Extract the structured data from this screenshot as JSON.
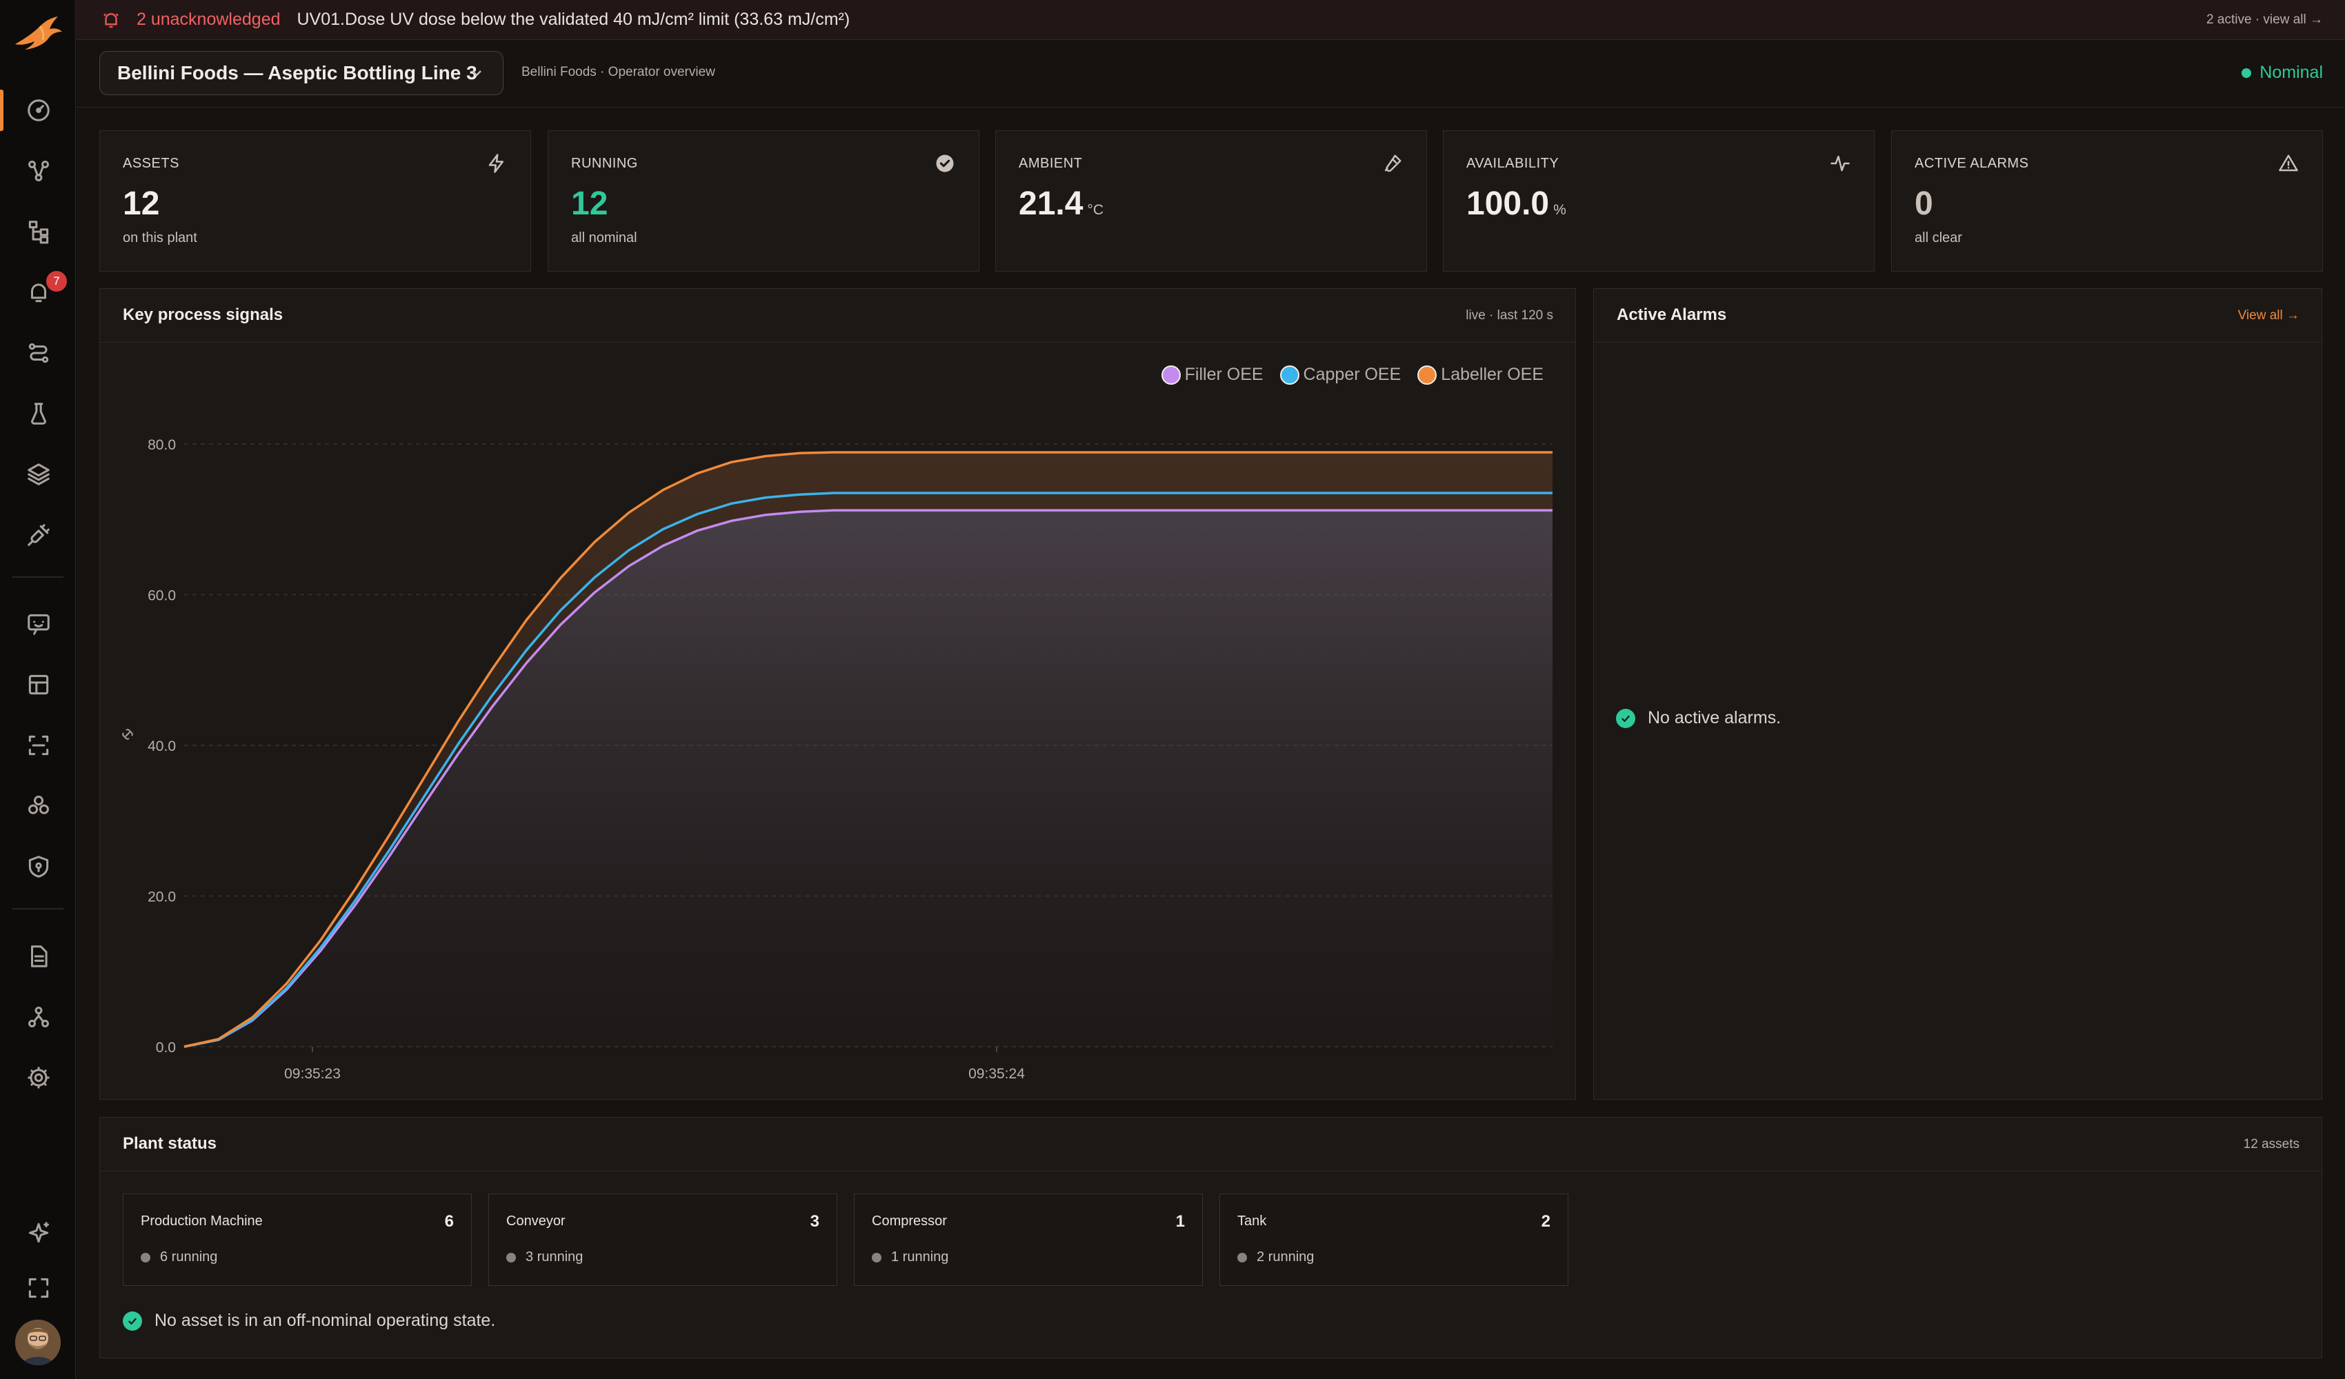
{
  "banner": {
    "unacknowledged": "2 unacknowledged",
    "message": "UV01.Dose UV dose below the validated 40 mJ/cm² limit (33.63 mJ/cm²)",
    "right": "2 active · view all →"
  },
  "header": {
    "plant": "Bellini Foods — Aseptic Bottling Line 3",
    "subtitle": "Bellini Foods · Operator overview",
    "status": "Nominal"
  },
  "sidebar": {
    "alarm_badge": "7"
  },
  "kpis": [
    {
      "label": "ASSETS",
      "value": "12",
      "unit": "",
      "sub": "on this plant",
      "icon": "bolt-icon"
    },
    {
      "label": "RUNNING",
      "value": "12",
      "unit": "",
      "sub": "all nominal",
      "icon": "check-circle-icon"
    },
    {
      "label": "AMBIENT",
      "value": "21.4",
      "unit": "°C",
      "sub": "",
      "icon": "thermometer-icon"
    },
    {
      "label": "AVAILABILITY",
      "value": "100.0",
      "unit": "%",
      "sub": "",
      "icon": "pulse-icon"
    },
    {
      "label": "ACTIVE ALARMS",
      "value": "0",
      "unit": "",
      "sub": "all clear",
      "icon": "warning-icon"
    }
  ],
  "signals": {
    "title": "Key process signals",
    "meta": "live · last 120 s"
  },
  "alarms": {
    "title": "Active Alarms",
    "view_all": "View all →",
    "empty": "No active alarms."
  },
  "plant_status": {
    "title": "Plant status",
    "meta": "12 assets",
    "types": [
      {
        "name": "Production Machine",
        "count": "6",
        "running": "6 running"
      },
      {
        "name": "Conveyor",
        "count": "3",
        "running": "3 running"
      },
      {
        "name": "Compressor",
        "count": "1",
        "running": "1 running"
      },
      {
        "name": "Tank",
        "count": "2",
        "running": "2 running"
      }
    ],
    "footer": "No asset is in an off-nominal operating state."
  },
  "colors": {
    "accent": "#f08a3a",
    "ok": "#2fc99a",
    "alert": "#e65454",
    "filler": "#c48bef",
    "capper": "#3bb3ec",
    "labeller": "#f08a3a"
  },
  "chart_data": {
    "type": "line",
    "ylim": [
      0,
      80
    ],
    "y_ticks": [
      "0.0",
      "20.0",
      "40.0",
      "60.0",
      "80.0"
    ],
    "x_ticks": [
      "09:35:23",
      "09:35:24"
    ],
    "y_axis_icon": "link-icon",
    "x": [
      0,
      1,
      2,
      3,
      4,
      5,
      6,
      7,
      8,
      9,
      10,
      11,
      12,
      13,
      14,
      15,
      16,
      17,
      18,
      19,
      20,
      21,
      22,
      23,
      24,
      25,
      26,
      27,
      28,
      29,
      30,
      31,
      32,
      33,
      34,
      35,
      36,
      37,
      38,
      39,
      40
    ],
    "legend_position": "top-right",
    "series": [
      {
        "name": "Filler OEE",
        "color": "#c48bef",
        "values": [
          0,
          0.9,
          3.5,
          7.6,
          12.8,
          18.8,
          25.3,
          32.1,
          38.8,
          45.1,
          50.9,
          56.0,
          60.3,
          63.8,
          66.5,
          68.5,
          69.8,
          70.6,
          71.0,
          71.2,
          71.2,
          71.2,
          71.2,
          71.2,
          71.2,
          71.2,
          71.2,
          71.2,
          71.2,
          71.2,
          71.2,
          71.2,
          71.2,
          71.2,
          71.2,
          71.2,
          71.2,
          71.2,
          71.2,
          71.2,
          71.2
        ]
      },
      {
        "name": "Capper OEE",
        "color": "#3bb3ec",
        "values": [
          0,
          0.9,
          3.6,
          7.8,
          13.2,
          19.4,
          26.1,
          33.1,
          40.1,
          46.6,
          52.6,
          57.9,
          62.3,
          65.9,
          68.7,
          70.7,
          72.1,
          72.9,
          73.3,
          73.5,
          73.5,
          73.5,
          73.5,
          73.5,
          73.5,
          73.5,
          73.5,
          73.5,
          73.5,
          73.5,
          73.5,
          73.5,
          73.5,
          73.5,
          73.5,
          73.5,
          73.5,
          73.5,
          73.5,
          73.5,
          73.5
        ]
      },
      {
        "name": "Labeller OEE",
        "color": "#f08a3a",
        "values": [
          0,
          1.0,
          3.9,
          8.4,
          14.2,
          20.9,
          28.1,
          35.6,
          43.1,
          50.1,
          56.6,
          62.2,
          67.0,
          70.9,
          73.9,
          76.1,
          77.6,
          78.4,
          78.8,
          78.9,
          78.9,
          78.9,
          78.9,
          78.9,
          78.9,
          78.9,
          78.9,
          78.9,
          78.9,
          78.9,
          78.9,
          78.9,
          78.9,
          78.9,
          78.9,
          78.9,
          78.9,
          78.9,
          78.9,
          78.9,
          78.9
        ]
      }
    ]
  }
}
